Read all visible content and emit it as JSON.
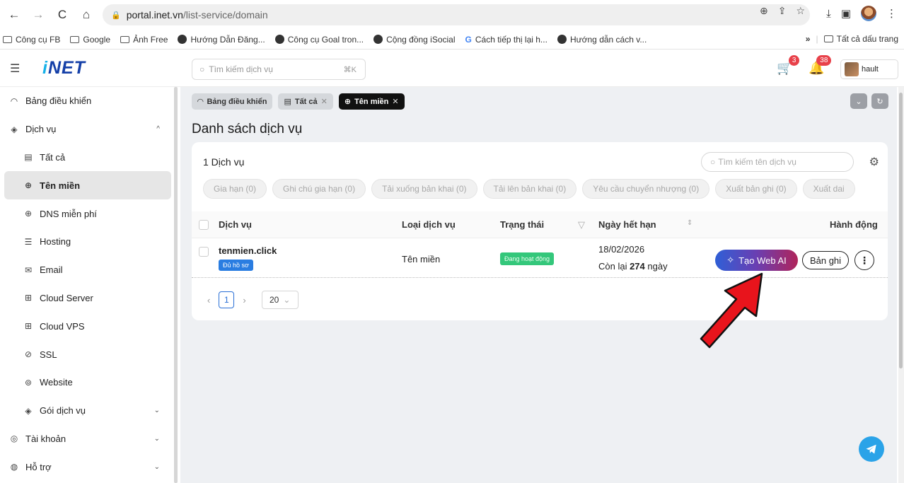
{
  "browser": {
    "url_host": "portal.inet.vn",
    "url_path": "/list-service/domain",
    "bookmarks": [
      "Công cụ FB",
      "Google",
      "Ảnh Free",
      "Hướng Dẫn Đăng...",
      "Công cụ Goal tron...",
      "Cộng đồng iSocial",
      "Cách tiếp thị lại h...",
      "Hướng dẫn cách v..."
    ],
    "all_bookmarks": "Tất cả dấu trang",
    "more": "»"
  },
  "header": {
    "logo_i": "i",
    "logo_rest": "NET",
    "search_placeholder": "Tìm kiếm dịch vụ",
    "search_kbd": "⌘K",
    "cart_count": "3",
    "notif_count": "38",
    "username": "hault"
  },
  "sidebar": {
    "dashboard": "Bảng điều khiển",
    "services": "Dịch vụ",
    "items": [
      "Tất cả",
      "Tên miền",
      "DNS miễn phí",
      "Hosting",
      "Email",
      "Cloud Server",
      "Cloud VPS",
      "SSL",
      "Website",
      "Gói dịch vụ"
    ],
    "account": "Tài khoản",
    "support": "Hỗ trợ"
  },
  "tabs": [
    "Bảng điều khiển",
    "Tất cả",
    "Tên miền"
  ],
  "main": {
    "title": "Danh sách dịch vụ",
    "count": "1 Dịch vụ",
    "search_placeholder": "Tìm kiếm tên dịch vụ",
    "actions": [
      "Gia hạn (0)",
      "Ghi chú gia hạn (0)",
      "Tải xuống bản khai (0)",
      "Tải lên bản khai (0)",
      "Yêu cầu chuyển nhượng (0)",
      "Xuất bản ghi (0)",
      "Xuất dai"
    ],
    "columns": [
      "Dịch vụ",
      "Loại dịch vụ",
      "Trạng thái",
      "Ngày hết hạn",
      "Hành động"
    ]
  },
  "row": {
    "domain": "tenmien.click",
    "docs_badge": "Đủ hồ sơ",
    "type": "Tên miền",
    "status": "Đang hoạt động",
    "expiry": "18/02/2026",
    "remain_prefix": "Còn lại ",
    "remain_days": "274",
    "remain_suffix": " ngày",
    "ai_button": "Tạo Web AI",
    "log_button": "Bản ghi"
  },
  "pager": {
    "current": "1",
    "page_size": "20"
  },
  "colors": {
    "brand": "#1540a8",
    "accent": "#2a6fd6",
    "status_green": "#34c77b",
    "badge_red": "#e8414a",
    "arrow_red": "#e8141c"
  }
}
